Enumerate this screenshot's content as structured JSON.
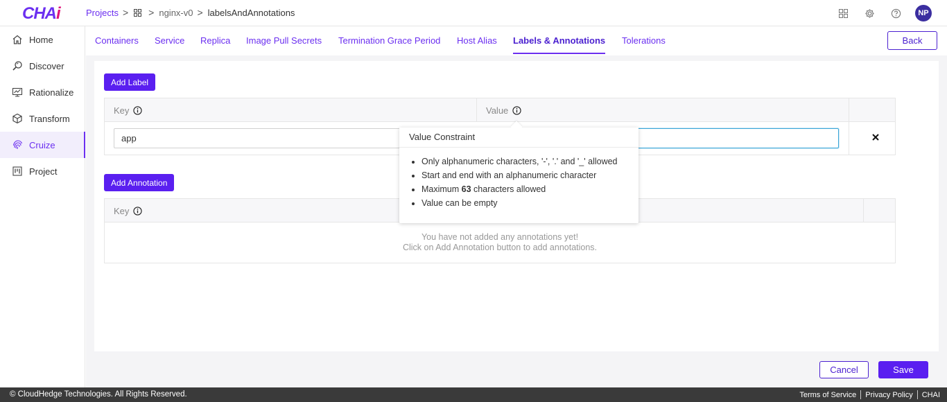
{
  "app": {
    "logo_main": "CHA",
    "logo_accent": "i"
  },
  "breadcrumb": {
    "projects": "Projects",
    "sep": ">",
    "app": "nginx-v0",
    "current": "labelsAndAnnotations"
  },
  "header": {
    "avatar_initials": "NP",
    "icons": [
      "apps-grid-icon",
      "gear-icon",
      "help-icon"
    ]
  },
  "sidebar": {
    "items": [
      {
        "label": "Home",
        "icon": "home-icon"
      },
      {
        "label": "Discover",
        "icon": "discover-icon"
      },
      {
        "label": "Rationalize",
        "icon": "rationalize-icon"
      },
      {
        "label": "Transform",
        "icon": "transform-icon"
      },
      {
        "label": "Cruize",
        "icon": "cruize-icon",
        "active": true
      },
      {
        "label": "Project",
        "icon": "project-icon"
      }
    ]
  },
  "tabs": {
    "items": [
      "Containers",
      "Service",
      "Replica",
      "Image Pull Secrets",
      "Termination Grace Period",
      "Host Alias",
      "Labels & Annotations",
      "Tolerations"
    ],
    "active": "Labels & Annotations",
    "back": "Back"
  },
  "labels": {
    "add_button": "Add Label",
    "key_header": "Key",
    "value_header": "Value",
    "rows": [
      {
        "key": "app",
        "value": ""
      }
    ]
  },
  "annotations": {
    "add_button": "Add Annotation",
    "key_header": "Key",
    "empty_line1": "You have not added any annotations yet!",
    "empty_line2": "Click on Add Annotation button to add annotations."
  },
  "tooltip": {
    "title": "Value Constraint",
    "item1": "Only alphanumeric characters, '-', '.' and '_' allowed",
    "item2": "Start and end with an alphanumeric character",
    "item3_pre": "Maximum ",
    "item3_bold": "63",
    "item3_post": " characters allowed",
    "item4": "Value can be empty"
  },
  "actions": {
    "cancel": "Cancel",
    "save": "Save"
  },
  "footer": {
    "copyright": "© CloudHedge Technologies. All Rights Reserved.",
    "terms": "Terms of Service",
    "privacy": "Privacy Policy",
    "brand": "CHAI"
  },
  "colors": {
    "accent": "#6b2ff0",
    "primary_button": "#5a1ff0",
    "footer_bg": "#3a3a3a"
  }
}
